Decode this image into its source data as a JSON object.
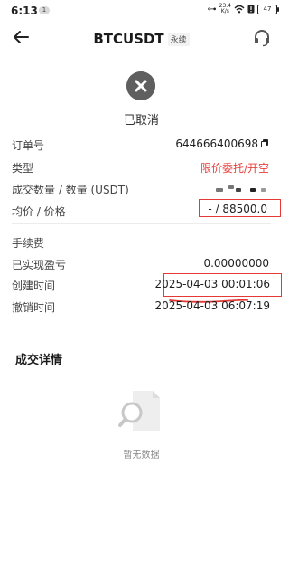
{
  "status_bar": {
    "time": "6:13",
    "notification_count": "1",
    "network_speed_value": "23.4",
    "network_speed_unit": "K/s",
    "battery": "47"
  },
  "header": {
    "title": "BTCUSDT",
    "tag": "永续"
  },
  "order_status": "已取消",
  "rows": [
    {
      "label": "订单号",
      "value": "644666400698"
    },
    {
      "label": "类型",
      "value": "限价委托/开空"
    },
    {
      "label": "成交数量 / 数量 (USDT)",
      "value": ""
    },
    {
      "label": "均价 / 价格",
      "value": "- / 88500.0"
    },
    {
      "label": "手续费",
      "value": ""
    },
    {
      "label": "已实现盈亏",
      "value": "0.00000000"
    },
    {
      "label": "创建时间",
      "value": "2025-04-03 00:01:06"
    },
    {
      "label": "撤销时间",
      "value": "2025-04-03 06:07:19"
    }
  ],
  "details": {
    "title": "成交详情",
    "empty_text": "暂无数据"
  },
  "colors": {
    "accent_red": "#e8433f",
    "annotation_red": "#e53935",
    "status_gray": "#5f5f5f"
  }
}
